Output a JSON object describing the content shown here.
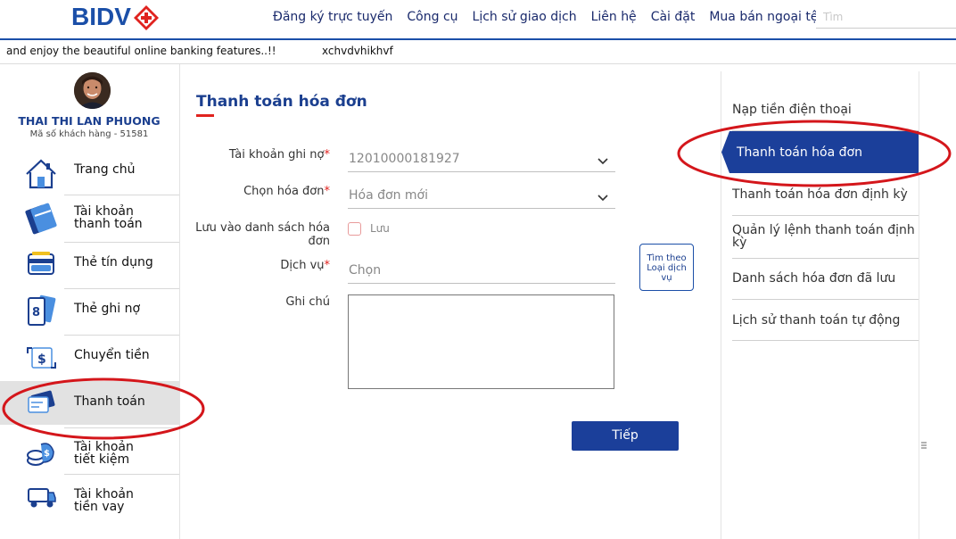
{
  "header": {
    "logo_text": "BIDV",
    "nav": [
      "Đăng ký trực tuyến",
      "Công cụ",
      "Lịch sử giao dịch",
      "Liên hệ",
      "Cài đặt",
      "Mua bán ngoại tệ"
    ],
    "search_placeholder": "Tìm"
  },
  "marquee": {
    "text1": "and enjoy the beautiful online banking features..!!",
    "text2": "xchvdvhikhvf"
  },
  "user": {
    "name": "THAI THI LAN PHUONG",
    "customer_id": "Mã số khách hàng - 51581"
  },
  "sidebar": {
    "items": [
      {
        "label": "Trang chủ",
        "icon": "home-icon"
      },
      {
        "label": "Tài khoản\nthanh toán",
        "icon": "payment-account-icon"
      },
      {
        "label": "Thẻ tín dụng",
        "icon": "credit-card-icon"
      },
      {
        "label": "Thẻ ghi nợ",
        "icon": "debit-card-icon"
      },
      {
        "label": "Chuyển tiền",
        "icon": "transfer-icon"
      },
      {
        "label": "Thanh toán",
        "icon": "bill-payment-icon",
        "active": true
      },
      {
        "label": "Tài khoản\ntiết kiệm",
        "icon": "savings-icon"
      },
      {
        "label": "Tài khoản\ntiền vay",
        "icon": "loan-icon"
      }
    ]
  },
  "form": {
    "title": "Thanh toán hóa đơn",
    "debit_account_label": "Tài khoản ghi nợ",
    "debit_account_value": "12010000181927",
    "bill_label": "Chọn hóa đơn",
    "bill_value": "Hóa đơn mới",
    "save_list_label": "Lưu vào danh sách hóa đơn",
    "save_checkbox_label": "Lưu",
    "service_label": "Dịch vụ",
    "service_placeholder": "Chọn",
    "note_label": "Ghi chú",
    "lookup_button": "Tìm theo Loại dịch vụ",
    "next_button": "Tiếp",
    "required_mark": "*"
  },
  "right_panel": {
    "items": [
      {
        "label": "Nạp tiền điện thoại"
      },
      {
        "label": "Thanh toán hóa đơn",
        "active": true
      },
      {
        "label": "Thanh toán hóa đơn định kỳ"
      },
      {
        "label": "Quản lý lệnh thanh toán định kỳ"
      },
      {
        "label": "Danh sách hóa đơn đã lưu"
      },
      {
        "label": "Lịch sử thanh toán tự động"
      }
    ]
  },
  "colors": {
    "brand_blue": "#1b4fa8",
    "brand_red": "#e0231f",
    "annotation_red": "#d4161b"
  }
}
